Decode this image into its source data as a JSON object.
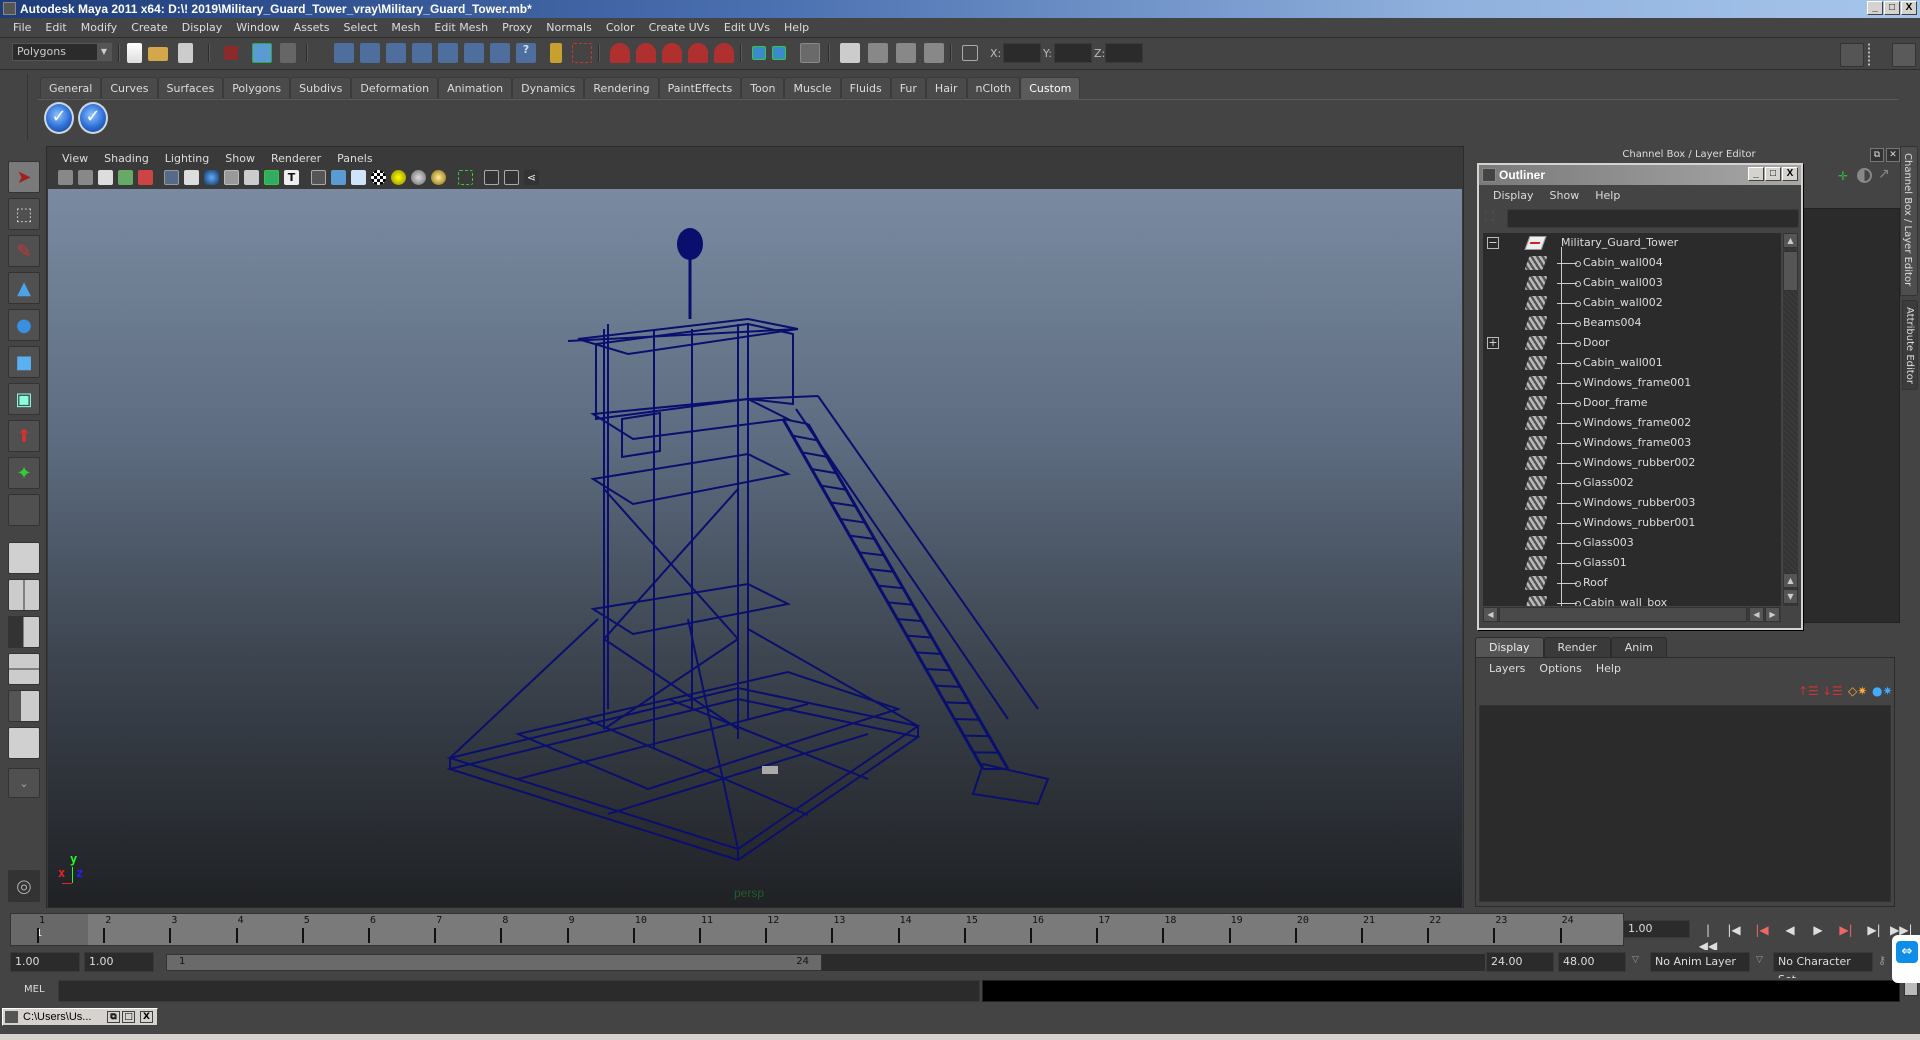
{
  "window": {
    "title": "Autodesk Maya 2011 x64: D:\\! 2019\\Military_Guard_Tower_vray\\Military_Guard_Tower.mb*",
    "minimize": "_",
    "maximize": "□",
    "close": "X"
  },
  "menubar": [
    "File",
    "Edit",
    "Modify",
    "Create",
    "Display",
    "Window",
    "Assets",
    "Select",
    "Mesh",
    "Edit Mesh",
    "Proxy",
    "Normals",
    "Color",
    "Create UVs",
    "Edit UVs",
    "Help"
  ],
  "statusline": {
    "menu_set": "Polygons",
    "menu_set_arrow": "▼",
    "coords": {
      "x_label": "X:",
      "y_label": "Y:",
      "z_label": "Z:",
      "x": "",
      "y": "",
      "z": ""
    }
  },
  "shelf": {
    "tabs": [
      "General",
      "Curves",
      "Surfaces",
      "Polygons",
      "Subdivs",
      "Deformation",
      "Animation",
      "Dynamics",
      "Rendering",
      "PaintEffects",
      "Toon",
      "Muscle",
      "Fluids",
      "Fur",
      "Hair",
      "nCloth",
      "Custom"
    ],
    "active_tab": "Custom",
    "buttons": [
      {
        "icon": "checkmark-icon",
        "glyph": "✓"
      },
      {
        "icon": "checkmark-icon",
        "glyph": "✓"
      }
    ]
  },
  "toolbox": {
    "tools": [
      {
        "name": "select-tool",
        "glyph": "➤",
        "active": true
      },
      {
        "name": "lasso-tool",
        "glyph": "⬚"
      },
      {
        "name": "paint-select-tool",
        "glyph": "✎"
      },
      {
        "name": "move-tool",
        "glyph": "▲"
      },
      {
        "name": "rotate-tool",
        "glyph": "●"
      },
      {
        "name": "scale-tool",
        "glyph": "■"
      },
      {
        "name": "universal-manipulator",
        "glyph": "▣"
      },
      {
        "name": "soft-modification-tool",
        "glyph": "⬆"
      },
      {
        "name": "show-manipulator-tool",
        "glyph": "✦"
      },
      {
        "name": "last-tool",
        "glyph": ""
      }
    ],
    "layout_menu_glyph": "⌄"
  },
  "viewport": {
    "menu": [
      "View",
      "Shading",
      "Lighting",
      "Show",
      "Renderer",
      "Panels"
    ],
    "camera_label": "persp",
    "axis": {
      "x": "x",
      "y": "y",
      "z": "z"
    },
    "wireframe_color": "#0a0f6e"
  },
  "channel_box": {
    "header": "Channel Box / Layer Editor",
    "side_tabs": [
      "Channel Box / Layer Editor",
      "Attribute Editor"
    ]
  },
  "outliner": {
    "title": "Outliner",
    "menu": [
      "Display",
      "Show",
      "Help"
    ],
    "filter_value": "",
    "root": {
      "label": "Military_Guard_Tower",
      "expanded": true,
      "expander": "−"
    },
    "children": [
      {
        "label": "Cabin_wall004"
      },
      {
        "label": "Cabin_wall003"
      },
      {
        "label": "Cabin_wall002"
      },
      {
        "label": "Beams004"
      },
      {
        "label": "Door",
        "expander": "+"
      },
      {
        "label": "Cabin_wall001"
      },
      {
        "label": "Windows_frame001"
      },
      {
        "label": "Door_frame"
      },
      {
        "label": "Windows_frame002"
      },
      {
        "label": "Windows_frame003"
      },
      {
        "label": "Windows_rubber002"
      },
      {
        "label": "Glass002"
      },
      {
        "label": "Windows_rubber003"
      },
      {
        "label": "Windows_rubber001"
      },
      {
        "label": "Glass003"
      },
      {
        "label": "Glass01"
      },
      {
        "label": "Roof"
      },
      {
        "label": "Cabin_wall_box"
      }
    ]
  },
  "layer_editor": {
    "tabs": [
      "Display",
      "Render",
      "Anim"
    ],
    "active_tab": "Display",
    "menu": [
      "Layers",
      "Options",
      "Help"
    ]
  },
  "timeline": {
    "start": 1,
    "end": 24,
    "tick_labels": [
      "1",
      "2",
      "3",
      "4",
      "5",
      "6",
      "7",
      "8",
      "9",
      "10",
      "11",
      "12",
      "13",
      "14",
      "15",
      "16",
      "17",
      "18",
      "19",
      "20",
      "21",
      "22",
      "23",
      "24"
    ],
    "current_frame": "1",
    "current_time": "1.00",
    "playback_buttons": [
      "go-to-start",
      "step-back-key",
      "step-back-frame",
      "play-backwards",
      "play-forwards",
      "step-forward-frame",
      "step-forward-key",
      "go-to-end"
    ],
    "playback_glyphs": [
      "|◀◀",
      "|◀",
      "|◀",
      "◀",
      "▶",
      "▶|",
      "▶|",
      "▶▶|"
    ]
  },
  "range": {
    "start_time": "1.00",
    "playback_start": "1.00",
    "slider_start": "1",
    "slider_end": "24",
    "playback_end": "24.00",
    "end_time": "48.00",
    "anim_layer": "No Anim Layer",
    "character_set": "No Character Set"
  },
  "command_line": {
    "label": "MEL",
    "value": ""
  },
  "taskbar": {
    "minimized_window": "C:\\Users\\Us..."
  }
}
